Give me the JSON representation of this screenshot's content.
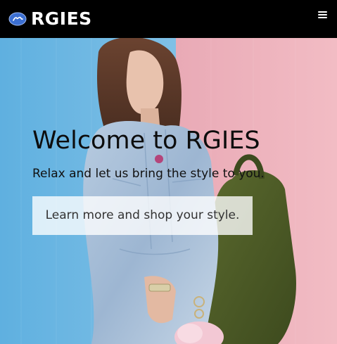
{
  "navbar": {
    "brand_name": "RGIES",
    "logo_icon": "rgies-logo-icon",
    "menu_icon": "hamburger-menu-icon",
    "background_color": "#000000"
  },
  "hero": {
    "title": "Welcome to RGIES",
    "subtitle": "Relax and let us bring the style to you.",
    "cta_label": "Learn more and shop your style.",
    "image_description_colors": {
      "left_wall": "#6ab4de",
      "right_wall": "#f0b4bd"
    }
  }
}
